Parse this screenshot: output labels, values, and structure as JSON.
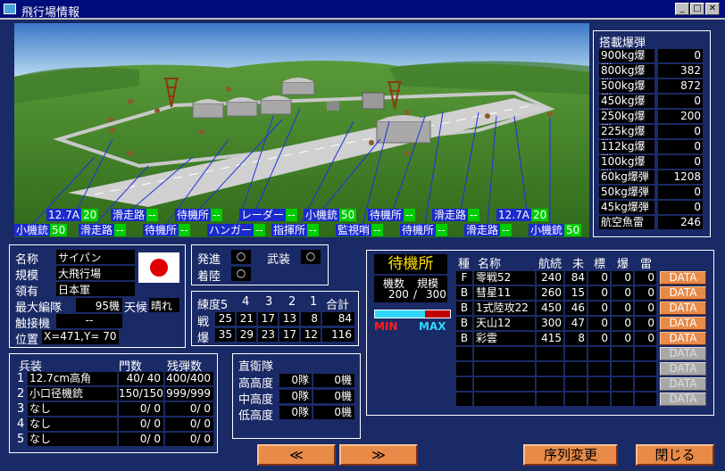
{
  "window": {
    "title": "飛行場情報"
  },
  "bombs": {
    "title": "搭載爆弾",
    "items": [
      {
        "name": "900kg爆弾",
        "value": "0"
      },
      {
        "name": "800kg爆弾",
        "value": "382"
      },
      {
        "name": "500kg爆弾",
        "value": "872"
      },
      {
        "name": "450kg爆弾",
        "value": "0"
      },
      {
        "name": "250kg爆弾",
        "value": "200"
      },
      {
        "name": "225kg爆弾",
        "value": "0"
      },
      {
        "name": "112kg爆弾",
        "value": "0"
      },
      {
        "name": "100kg爆弾",
        "value": "0"
      },
      {
        "name": "60kg爆弾",
        "value": "1208"
      },
      {
        "name": "50kg爆弾",
        "value": "0"
      },
      {
        "name": "45kg爆弾",
        "value": "0"
      },
      {
        "name": "航空魚雷",
        "value": "246"
      }
    ]
  },
  "map_labels": {
    "row1": [
      {
        "text": "12.7A",
        "value": "20"
      },
      {
        "text": "滑走路",
        "value": "--"
      },
      {
        "text": "待機所",
        "value": "--"
      },
      {
        "text": "レーダー",
        "value": "--"
      },
      {
        "text": "小機銃",
        "value": "50"
      },
      {
        "text": "待機所",
        "value": "--"
      },
      {
        "text": "滑走路",
        "value": "--"
      },
      {
        "text": "12.7A",
        "value": "20"
      }
    ],
    "row2": [
      {
        "text": "小機銃",
        "value": "50"
      },
      {
        "text": "滑走路",
        "value": "--"
      },
      {
        "text": "待機所",
        "value": "--"
      },
      {
        "text": "ハンガー",
        "value": "--"
      },
      {
        "text": "指揮所",
        "value": "--"
      },
      {
        "text": "監視哨",
        "value": "--"
      },
      {
        "text": "待機所",
        "value": "--"
      },
      {
        "text": "滑走路",
        "value": "--"
      },
      {
        "text": "小機銃",
        "value": "50"
      }
    ]
  },
  "info": {
    "name_label": "名称",
    "name": "サイパン",
    "scale_label": "規模",
    "scale": "大飛行場",
    "owner_label": "領有",
    "owner": "日本軍",
    "max_label": "最大編隊",
    "max": "95機",
    "weather_label": "天候",
    "weather": "晴れ",
    "contact_label": "触接機",
    "contact": "--",
    "pos_label": "位置",
    "pos": "X=471,Y= 70"
  },
  "status": {
    "launch_label": "発進",
    "launch": "○",
    "arm_label": "武装",
    "arm": "○",
    "land_label": "着陸",
    "land": "○"
  },
  "training": {
    "headers": [
      "練度5",
      "4",
      "3",
      "2",
      "1",
      "合計"
    ],
    "rows": [
      {
        "label": "戦",
        "values": [
          "25",
          "21",
          "17",
          "13",
          "8",
          "84"
        ]
      },
      {
        "label": "爆",
        "values": [
          "35",
          "29",
          "23",
          "17",
          "12",
          "116"
        ]
      }
    ]
  },
  "arms": {
    "headers": {
      "type": "兵装",
      "count": "門数",
      "ammo": "残弾数"
    },
    "rows": [
      {
        "no": "1",
        "name": "12.7cm高角",
        "count": "40/ 40",
        "ammo": "400/400"
      },
      {
        "no": "2",
        "name": "小口径機銃",
        "count": "150/150",
        "ammo": "999/999"
      },
      {
        "no": "3",
        "name": "なし",
        "count": "0/ 0",
        "ammo": "0/ 0"
      },
      {
        "no": "4",
        "name": "なし",
        "count": "0/ 0",
        "ammo": "0/ 0"
      },
      {
        "no": "5",
        "name": "なし",
        "count": "0/ 0",
        "ammo": "0/ 0"
      }
    ]
  },
  "guard": {
    "title": "直衛隊",
    "rows": [
      {
        "label": "高高度",
        "squads": "0隊",
        "planes": "0機"
      },
      {
        "label": "中高度",
        "squads": "0隊",
        "planes": "0機"
      },
      {
        "label": "低高度",
        "squads": "0隊",
        "planes": "0機"
      }
    ]
  },
  "standby": {
    "title": "待機所",
    "count_label": "機数",
    "scale_label": "規模",
    "count": "200",
    "capacity": "300",
    "min_label": "MIN",
    "max_label": "MAX",
    "gauge_fraction": 0.67,
    "headers": {
      "type": "種",
      "name": "名称",
      "range": "航続",
      "unassigned": "未",
      "target": "標",
      "bomb": "爆",
      "torpedo": "雷"
    },
    "rows": [
      {
        "type": "F",
        "name": "零戦52",
        "range": "240",
        "unassigned": "84",
        "target": "0",
        "bomb": "0",
        "torpedo": "0",
        "button": "DATA"
      },
      {
        "type": "B",
        "name": "彗星11",
        "range": "260",
        "unassigned": "15",
        "target": "0",
        "bomb": "0",
        "torpedo": "0",
        "button": "DATA"
      },
      {
        "type": "B",
        "name": "1式陸攻22",
        "range": "450",
        "unassigned": "46",
        "target": "0",
        "bomb": "0",
        "torpedo": "0",
        "button": "DATA"
      },
      {
        "type": "B",
        "name": "天山12",
        "range": "300",
        "unassigned": "47",
        "target": "0",
        "bomb": "0",
        "torpedo": "0",
        "button": "DATA"
      },
      {
        "type": "B",
        "name": "彩雲",
        "range": "415",
        "unassigned": "8",
        "target": "0",
        "bomb": "0",
        "torpedo": "0",
        "button": "DATA"
      }
    ],
    "empty_buttons": [
      "DATA",
      "DATA",
      "DATA",
      "DATA"
    ]
  },
  "buttons": {
    "prev": "≪",
    "next": "≫",
    "reorder": "序列変更",
    "close": "閉じる"
  }
}
